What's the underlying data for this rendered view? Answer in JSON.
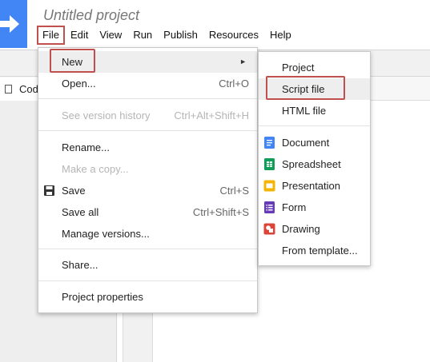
{
  "app": {
    "title": "Untitled project"
  },
  "menubar": [
    {
      "label": "File"
    },
    {
      "label": "Edit"
    },
    {
      "label": "View"
    },
    {
      "label": "Run"
    },
    {
      "label": "Publish"
    },
    {
      "label": "Resources"
    },
    {
      "label": "Help"
    }
  ],
  "editor": {
    "file_tab_label": "Cod"
  },
  "file_menu": {
    "new": {
      "label": "New",
      "has_submenu": true
    },
    "open": {
      "label": "Open...",
      "shortcut": "Ctrl+O"
    },
    "see_version_history": {
      "label": "See version history",
      "shortcut": "Ctrl+Alt+Shift+H",
      "disabled": true
    },
    "rename": {
      "label": "Rename..."
    },
    "make_a_copy": {
      "label": "Make a copy...",
      "disabled": true
    },
    "save": {
      "label": "Save",
      "shortcut": "Ctrl+S",
      "icon": "floppy-disk-icon"
    },
    "save_all": {
      "label": "Save all",
      "shortcut": "Ctrl+Shift+S"
    },
    "manage_versions": {
      "label": "Manage versions..."
    },
    "share": {
      "label": "Share..."
    },
    "project_properties": {
      "label": "Project properties"
    }
  },
  "new_submenu": {
    "project": {
      "label": "Project"
    },
    "script_file": {
      "label": "Script file",
      "highlighted": true
    },
    "html_file": {
      "label": "HTML file"
    },
    "document": {
      "label": "Document",
      "icon": "document-icon",
      "color": "#4285f4"
    },
    "spreadsheet": {
      "label": "Spreadsheet",
      "icon": "spreadsheet-icon",
      "color": "#0f9d58"
    },
    "presentation": {
      "label": "Presentation",
      "icon": "presentation-icon",
      "color": "#f4b400"
    },
    "form": {
      "label": "Form",
      "icon": "form-icon",
      "color": "#673ab7"
    },
    "drawing": {
      "label": "Drawing",
      "icon": "drawing-icon",
      "color": "#db4437"
    },
    "from_template": {
      "label": "From template..."
    }
  },
  "colors": {
    "brand_blue": "#4285f4",
    "callout_red": "#c0504d",
    "menu_highlight": "#eeeeee"
  }
}
